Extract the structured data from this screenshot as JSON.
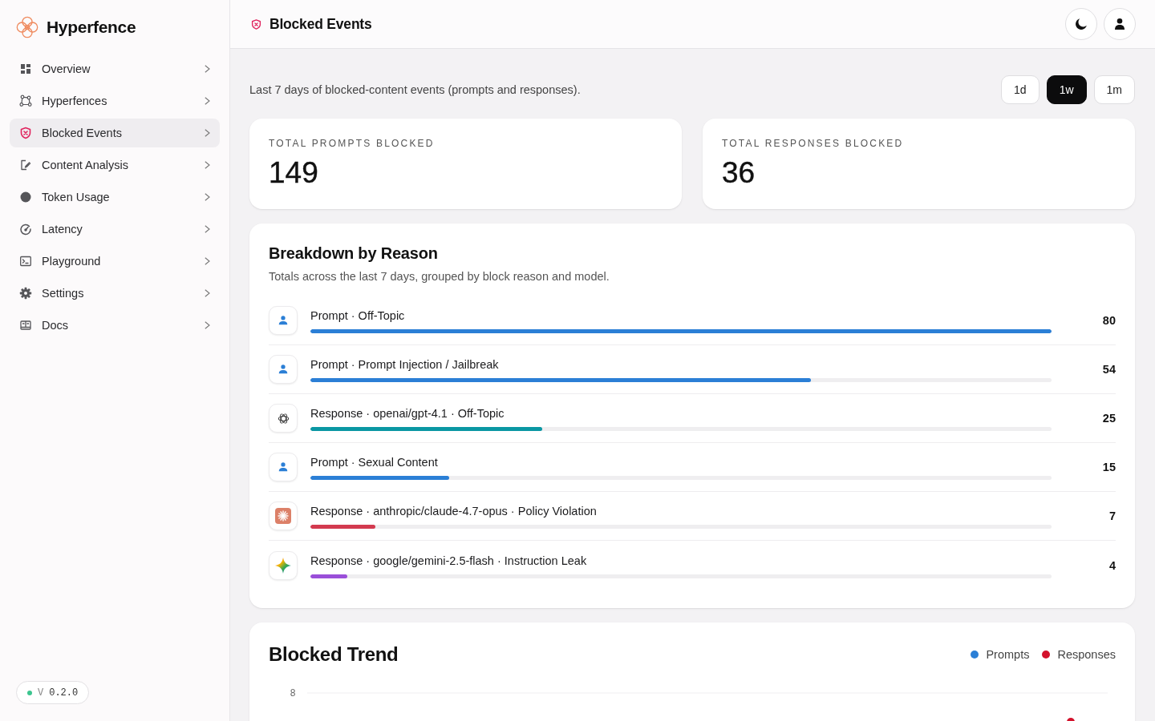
{
  "sidebar": {
    "brand": "Hyperfence",
    "items": [
      {
        "label": "Overview",
        "selected": false
      },
      {
        "label": "Hyperfences",
        "selected": false
      },
      {
        "label": "Blocked Events",
        "selected": true
      },
      {
        "label": "Content Analysis",
        "selected": false
      },
      {
        "label": "Token Usage",
        "selected": false
      },
      {
        "label": "Latency",
        "selected": false
      },
      {
        "label": "Playground",
        "selected": false
      },
      {
        "label": "Settings",
        "selected": false
      },
      {
        "label": "Docs",
        "selected": false
      }
    ],
    "version": {
      "prefix": "V",
      "number": "0.2.0"
    }
  },
  "header": {
    "title": "Blocked Events"
  },
  "toolbar": {
    "description": "Last 7 days of blocked-content events (prompts and responses).",
    "ranges": [
      {
        "label": "1d",
        "selected": false
      },
      {
        "label": "1w",
        "selected": true
      },
      {
        "label": "1m",
        "selected": false
      }
    ]
  },
  "stats": [
    {
      "label": "TOTAL PROMPTS BLOCKED",
      "value": "149"
    },
    {
      "label": "TOTAL RESPONSES BLOCKED",
      "value": "36"
    }
  ],
  "breakdown": {
    "title": "Breakdown by Reason",
    "subtitle": "Totals across the last 7 days, grouped by block reason and model.",
    "rows": [
      {
        "kind": "user",
        "label": "Prompt · Off-Topic",
        "count": "80",
        "level": 1,
        "color": "#2b7fd6"
      },
      {
        "kind": "user",
        "label": "Prompt · Prompt Injection / Jailbreak",
        "count": "54",
        "level": 0.675,
        "color": "#2b7fd6"
      },
      {
        "kind": "knot",
        "label": "Response · openai/gpt-4.1 · Off-Topic",
        "count": "25",
        "level": 0.3125,
        "color": "#0a97a3"
      },
      {
        "kind": "user",
        "label": "Prompt · Sexual Content",
        "count": "15",
        "level": 0.1875,
        "color": "#2b7fd6"
      },
      {
        "kind": "burst",
        "label": "Response · anthropic/claude-4.7-opus · Policy Violation",
        "count": "7",
        "level": 0.0875,
        "color": "#d33a4f"
      },
      {
        "kind": "sparkle",
        "label": "Response · google/gemini-2.5-flash · Instruction Leak",
        "count": "4",
        "level": 0.05,
        "color": "#9a4fd9"
      }
    ]
  },
  "trend": {
    "title": "Blocked Trend",
    "legend": [
      {
        "name": "Prompts",
        "color": "#2b7fd6"
      },
      {
        "name": "Responses",
        "color": "#d3122c"
      }
    ],
    "y_tick_labels": [
      "8"
    ]
  }
}
